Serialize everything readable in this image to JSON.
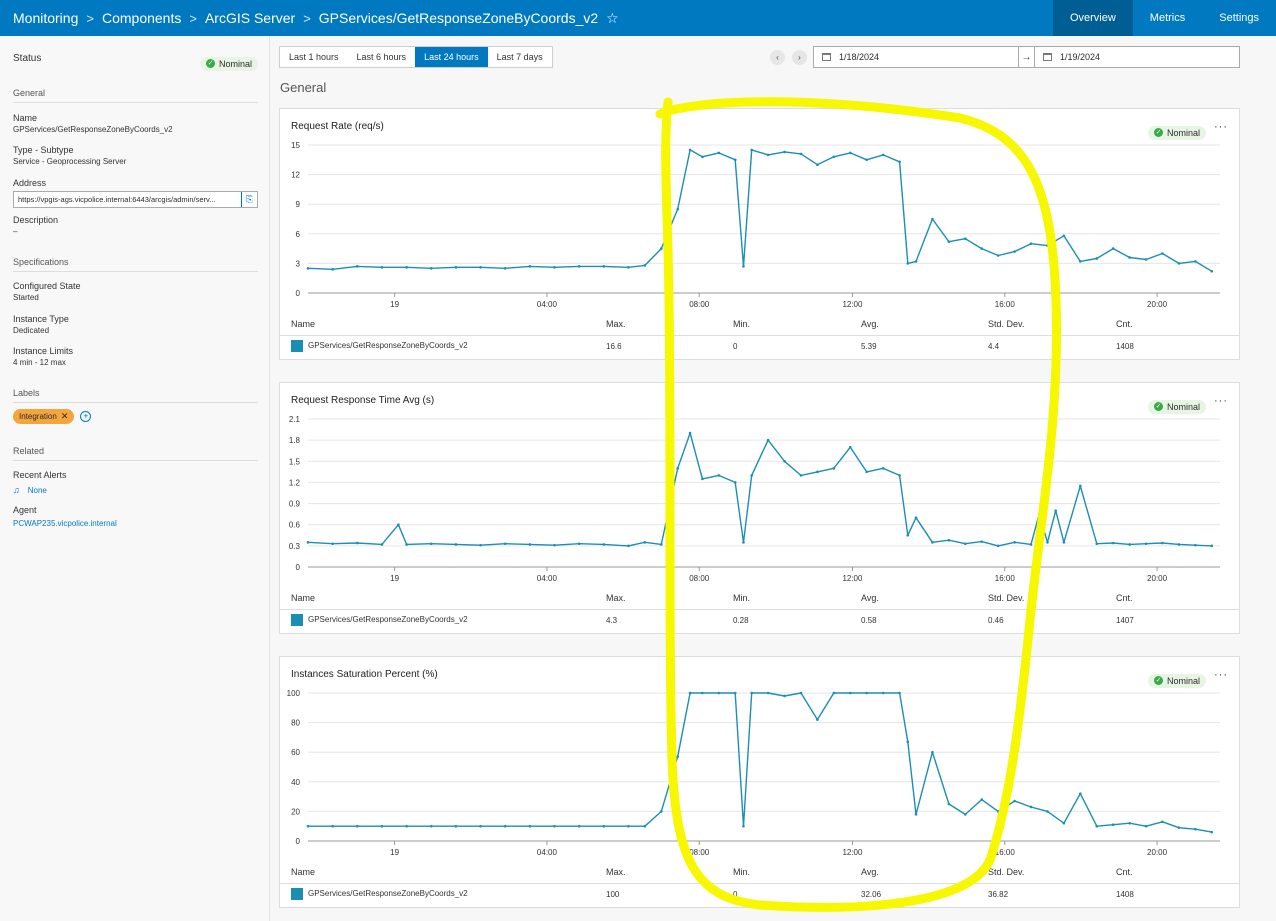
{
  "header": {
    "breadcrumbs": [
      "Monitoring",
      "Components",
      "ArcGIS Server",
      "GPServices/GetResponseZoneByCoords_v2"
    ],
    "tabs": [
      "Overview",
      "Metrics",
      "Settings"
    ],
    "active_tab": "Overview"
  },
  "sidebar": {
    "status_label": "Status",
    "status_value": "Nominal",
    "general_heading": "General",
    "name_label": "Name",
    "name_value": "GPServices/GetResponseZoneByCoords_v2",
    "type_label": "Type - Subtype",
    "type_value": "Service - Geoprocessing Server",
    "address_label": "Address",
    "address_value": "https://vpgis-ags.vicpolice.internal:6443/arcgis/admin/serv...",
    "description_label": "Description",
    "description_value": "–",
    "specs_heading": "Specifications",
    "configured_state_label": "Configured State",
    "configured_state_value": "Started",
    "instance_type_label": "Instance Type",
    "instance_type_value": "Dedicated",
    "instance_limits_label": "Instance Limits",
    "instance_limits_value": "4 min - 12 max",
    "labels_heading": "Labels",
    "label_chip": "Integration",
    "related_heading": "Related",
    "recent_alerts_label": "Recent Alerts",
    "recent_alerts_value": "None",
    "agent_label": "Agent",
    "agent_value": "PCWAP235.vicpolice.internal"
  },
  "time": {
    "ranges": [
      "Last 1 hours",
      "Last 6 hours",
      "Last 24 hours",
      "Last 7 days"
    ],
    "active": "Last 24 hours",
    "start_date": "1/18/2024",
    "end_date": "1/19/2024",
    "arrow": "→"
  },
  "main": {
    "section_title": "General"
  },
  "legend_columns": [
    "Name",
    "Max.",
    "Min.",
    "Avg.",
    "Std. Dev.",
    "Cnt."
  ],
  "colors": {
    "accent": "#0079c1",
    "series": "#1b8fb3",
    "highlight": "#f6f700",
    "nominal": "#35ac46",
    "chip": "#f5a53d"
  },
  "chart_data": [
    {
      "type": "line",
      "title": "Request Rate (req/s)",
      "status": "Nominal",
      "x_ticks": [
        "19",
        "04:00",
        "08:00",
        "12:00",
        "16:00",
        "20:00"
      ],
      "ylim": [
        0,
        15
      ],
      "y_ticks": [
        0,
        3,
        6,
        9,
        12,
        15
      ],
      "x_hours": [
        0,
        0.6,
        1.2,
        1.8,
        2.4,
        3,
        3.6,
        4.2,
        4.8,
        5.4,
        6,
        6.6,
        7.2,
        7.8,
        8.2,
        8.6,
        9,
        9.3,
        9.6,
        10,
        10.4,
        10.6,
        10.8,
        11.2,
        11.6,
        12,
        12.4,
        12.8,
        13.2,
        13.6,
        14,
        14.4,
        14.6,
        14.8,
        15.2,
        15.6,
        16,
        16.4,
        16.8,
        17.2,
        17.6,
        18,
        18.4,
        18.8,
        19.2,
        19.6,
        20,
        20.4,
        20.8,
        21.2,
        21.6,
        22
      ],
      "series": [
        {
          "name": "GPServices/GetResponseZoneByCoords_v2",
          "values": [
            2.5,
            2.4,
            2.7,
            2.6,
            2.6,
            2.5,
            2.6,
            2.6,
            2.5,
            2.7,
            2.6,
            2.7,
            2.7,
            2.6,
            2.8,
            4.5,
            8.5,
            14.5,
            13.8,
            14.2,
            13.5,
            2.7,
            14.5,
            14.0,
            14.3,
            14.1,
            13.0,
            13.8,
            14.2,
            13.5,
            14.0,
            13.3,
            3.0,
            3.2,
            7.5,
            5.2,
            5.5,
            4.5,
            3.8,
            4.2,
            5.0,
            4.8,
            5.8,
            3.2,
            3.5,
            4.5,
            3.6,
            3.4,
            4.0,
            3.0,
            3.2,
            2.2
          ]
        }
      ],
      "stats": {
        "max": "16.6",
        "min": "0",
        "avg": "5.39",
        "std": "4.4",
        "cnt": "1408"
      }
    },
    {
      "type": "line",
      "title": "Request Response Time Avg (s)",
      "status": "Nominal",
      "x_ticks": [
        "19",
        "04:00",
        "08:00",
        "12:00",
        "16:00",
        "20:00"
      ],
      "ylim": [
        0,
        2.1
      ],
      "y_ticks": [
        "0",
        "0.3",
        "0.6",
        "0.9",
        "1.2",
        "1.5",
        "1.8",
        "2.1"
      ],
      "x_hours": [
        0,
        0.6,
        1.2,
        1.8,
        2.2,
        2.4,
        3,
        3.6,
        4.2,
        4.8,
        5.4,
        6,
        6.6,
        7.2,
        7.8,
        8.2,
        8.6,
        9,
        9.3,
        9.6,
        10,
        10.4,
        10.6,
        10.8,
        11.2,
        11.6,
        12,
        12.4,
        12.8,
        13.2,
        13.6,
        14,
        14.4,
        14.6,
        14.8,
        15.2,
        15.6,
        16,
        16.4,
        16.8,
        17.2,
        17.6,
        17.8,
        18,
        18.2,
        18.4,
        18.8,
        19.2,
        19.6,
        20,
        20.4,
        20.8,
        21.2,
        21.6,
        22
      ],
      "series": [
        {
          "name": "GPServices/GetResponseZoneByCoords_v2",
          "values": [
            0.35,
            0.33,
            0.34,
            0.32,
            0.6,
            0.32,
            0.33,
            0.32,
            0.31,
            0.33,
            0.32,
            0.31,
            0.33,
            0.32,
            0.3,
            0.35,
            0.32,
            1.4,
            1.9,
            1.25,
            1.3,
            1.2,
            0.35,
            1.3,
            1.8,
            1.5,
            1.3,
            1.35,
            1.4,
            1.7,
            1.35,
            1.4,
            1.3,
            0.45,
            0.7,
            0.35,
            0.38,
            0.33,
            0.36,
            0.3,
            0.35,
            0.32,
            0.75,
            0.35,
            0.8,
            0.35,
            1.15,
            0.33,
            0.34,
            0.32,
            0.33,
            0.34,
            0.32,
            0.31,
            0.3
          ]
        }
      ],
      "stats": {
        "max": "4.3",
        "min": "0.28",
        "avg": "0.58",
        "std": "0.46",
        "cnt": "1407"
      }
    },
    {
      "type": "line",
      "title": "Instances Saturation Percent (%)",
      "status": "Nominal",
      "x_ticks": [
        "19",
        "04:00",
        "08:00",
        "12:00",
        "16:00",
        "20:00"
      ],
      "ylim": [
        0,
        100
      ],
      "y_ticks": [
        0,
        20,
        40,
        60,
        80,
        100
      ],
      "x_hours": [
        0,
        0.6,
        1.2,
        1.8,
        2.4,
        3,
        3.6,
        4.2,
        4.8,
        5.4,
        6,
        6.6,
        7.2,
        7.8,
        8.2,
        8.6,
        9,
        9.3,
        9.6,
        10,
        10.4,
        10.6,
        10.8,
        11.2,
        11.6,
        12,
        12.4,
        12.8,
        13.2,
        13.6,
        14,
        14.4,
        14.6,
        14.8,
        15.2,
        15.6,
        16,
        16.4,
        16.8,
        17.2,
        17.6,
        18,
        18.4,
        18.8,
        19.2,
        19.6,
        20,
        20.4,
        20.8,
        21.2,
        21.6,
        22
      ],
      "series": [
        {
          "name": "GPServices/GetResponseZoneByCoords_v2",
          "values": [
            10,
            10,
            10,
            10,
            10,
            10,
            10,
            10,
            10,
            10,
            10,
            10,
            10,
            10,
            10,
            20,
            57,
            100,
            100,
            100,
            100,
            10,
            100,
            100,
            98,
            100,
            82,
            100,
            100,
            100,
            100,
            100,
            67,
            18,
            60,
            25,
            18,
            28,
            20,
            27,
            23,
            20,
            12,
            32,
            10,
            11,
            12,
            10,
            13,
            9,
            8,
            6
          ]
        }
      ],
      "stats": {
        "max": "100",
        "min": "0",
        "avg": "32.06",
        "std": "36.82",
        "cnt": "1408"
      }
    }
  ]
}
